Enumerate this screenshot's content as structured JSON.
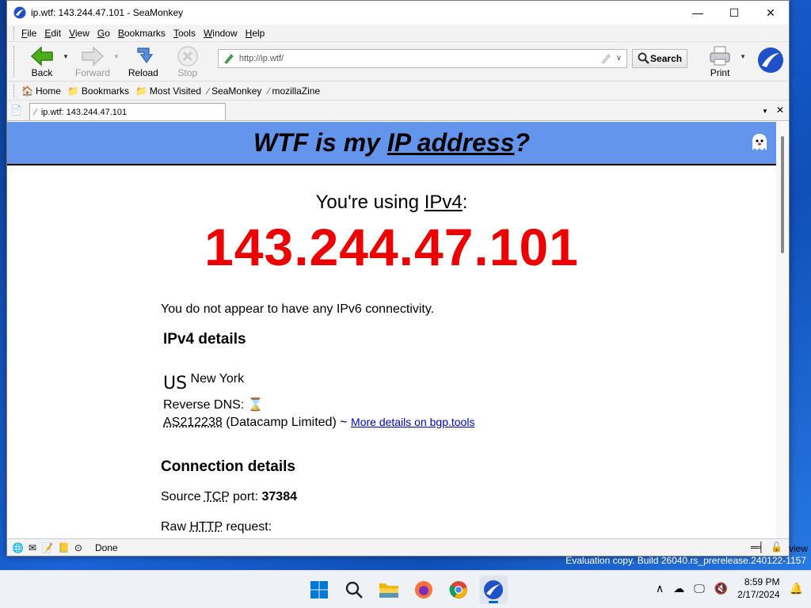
{
  "window": {
    "title": "ip.wtf: 143.244.47.101 - SeaMonkey"
  },
  "menu": [
    "File",
    "Edit",
    "View",
    "Go",
    "Bookmarks",
    "Tools",
    "Window",
    "Help"
  ],
  "menu_access": [
    "F",
    "E",
    "V",
    "G",
    "B",
    "T",
    "W",
    "H"
  ],
  "nav": {
    "back": "Back",
    "forward": "Forward",
    "reload": "Reload",
    "stop": "Stop",
    "search": "Search",
    "print": "Print"
  },
  "url": {
    "value": "http://ip.wtf/"
  },
  "bookmarks": [
    "Home",
    "Bookmarks",
    "Most Visited",
    "SeaMonkey",
    "mozillaZine"
  ],
  "tab": {
    "label": "ip.wtf: 143.244.47.101"
  },
  "page": {
    "header_pre": "WTF is my ",
    "header_link": "IP address",
    "header_post": "?",
    "using_pre": "You're using ",
    "using_link": "IPv4",
    "using_post": ":",
    "ip": "143.244.47.101",
    "ipv6_note": "You do not appear to have any IPv6 connectivity.",
    "ipv4_heading": "IPv4 details",
    "country": "US",
    "city": "New York",
    "rdns_label": "Reverse DNS:",
    "as_number": "AS212238",
    "as_name": "(Datacamp Limited) ~",
    "bgp_link": "More details on bgp.tools",
    "conn_heading": "Connection details",
    "src_port_label_pre": "Source ",
    "src_port_abbr": "TCP",
    "src_port_label_post": " port:",
    "src_port": "37384",
    "raw_pre": "Raw ",
    "raw_abbr": "HTTP",
    "raw_post": " request:"
  },
  "status": {
    "text": "Done"
  },
  "watermark": "Evaluation copy. Build 26040.rs_prerelease.240122-1157",
  "view_label": "view",
  "clock": {
    "time": "8:59 PM",
    "date": "2/17/2024"
  },
  "colors": {
    "header_bg": "#6495ed",
    "ip_red": "#e00000",
    "link": "#0000cc"
  }
}
